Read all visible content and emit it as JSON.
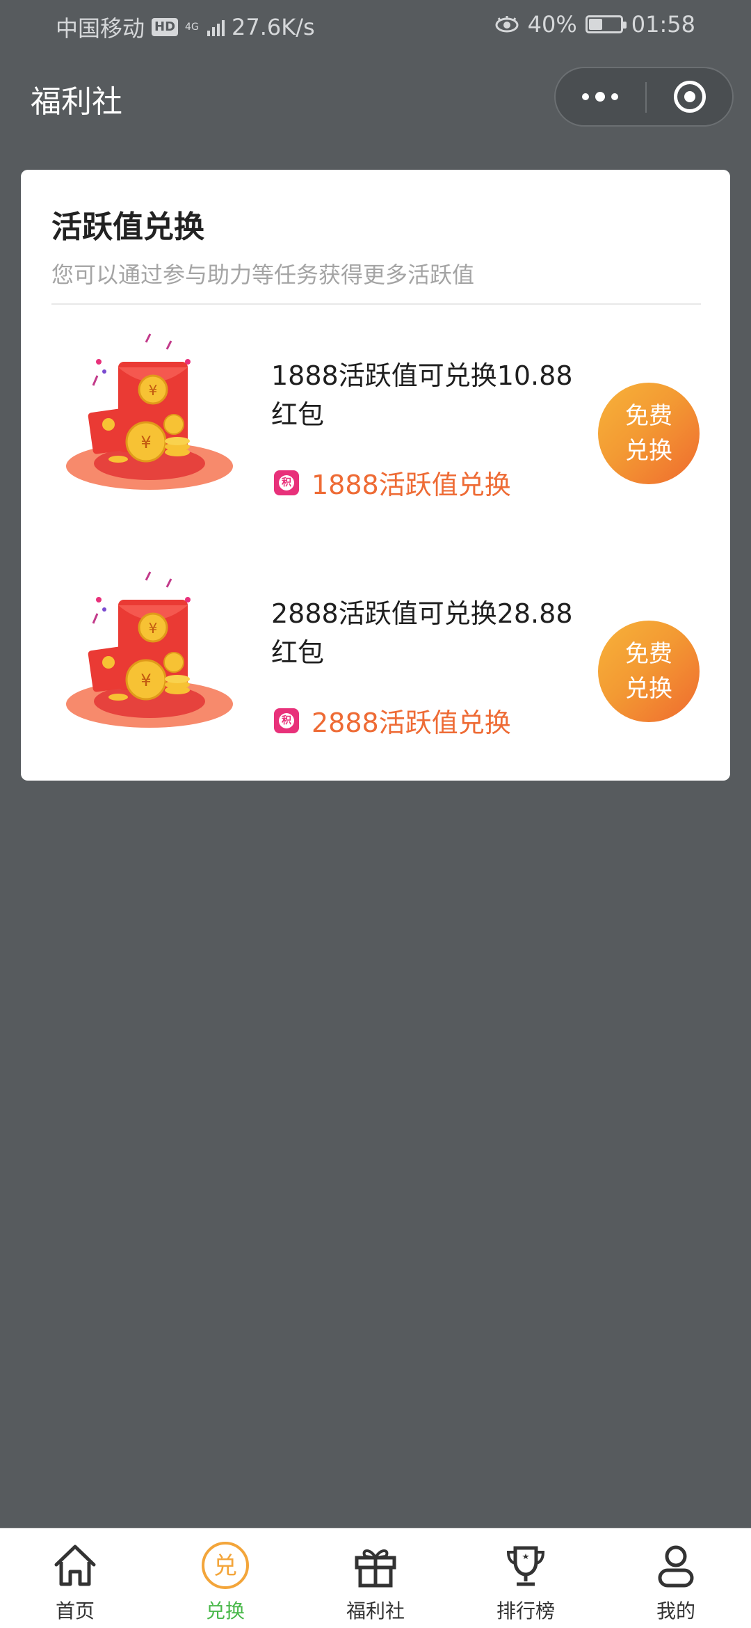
{
  "status_bar": {
    "carrier": "中国移动",
    "hd": "HD",
    "network": "4G",
    "speed": "27.6K/s",
    "battery": "40%",
    "battery_level": 0.4,
    "time": "01:58"
  },
  "nav": {
    "title": "福利社",
    "more_icon": "more-dots-icon",
    "close_icon": "target-circle-icon"
  },
  "card": {
    "title": "活跃值兑换",
    "subtitle": "您可以通过参与助力等任务获得更多活跃值",
    "items": [
      {
        "name": "1888活跃值可兑换10.88红包",
        "cost": "1888活跃值兑换",
        "button_line1": "免费",
        "button_line2": "兑换",
        "image_icon": "red-envelope-illustration"
      },
      {
        "name": "2888活跃值可兑换28.88红包",
        "cost": "2888活跃值兑换",
        "button_line1": "免费",
        "button_line2": "兑换",
        "image_icon": "red-envelope-illustration"
      }
    ],
    "points_icon_glyph": "积"
  },
  "tabbar": {
    "tabs": [
      {
        "label": "首页",
        "icon": "home-icon",
        "active": false
      },
      {
        "label": "兑换",
        "icon": "exchange-icon",
        "icon_glyph": "兑",
        "active": true
      },
      {
        "label": "福利社",
        "icon": "gift-icon",
        "active": false
      },
      {
        "label": "排行榜",
        "icon": "trophy-icon",
        "active": false
      },
      {
        "label": "我的",
        "icon": "user-icon",
        "active": false
      }
    ]
  },
  "colors": {
    "background": "#575b5e",
    "accent_orange": "#ee6b35",
    "active_tab": "#49b84a",
    "points_pink": "#e8317a"
  }
}
